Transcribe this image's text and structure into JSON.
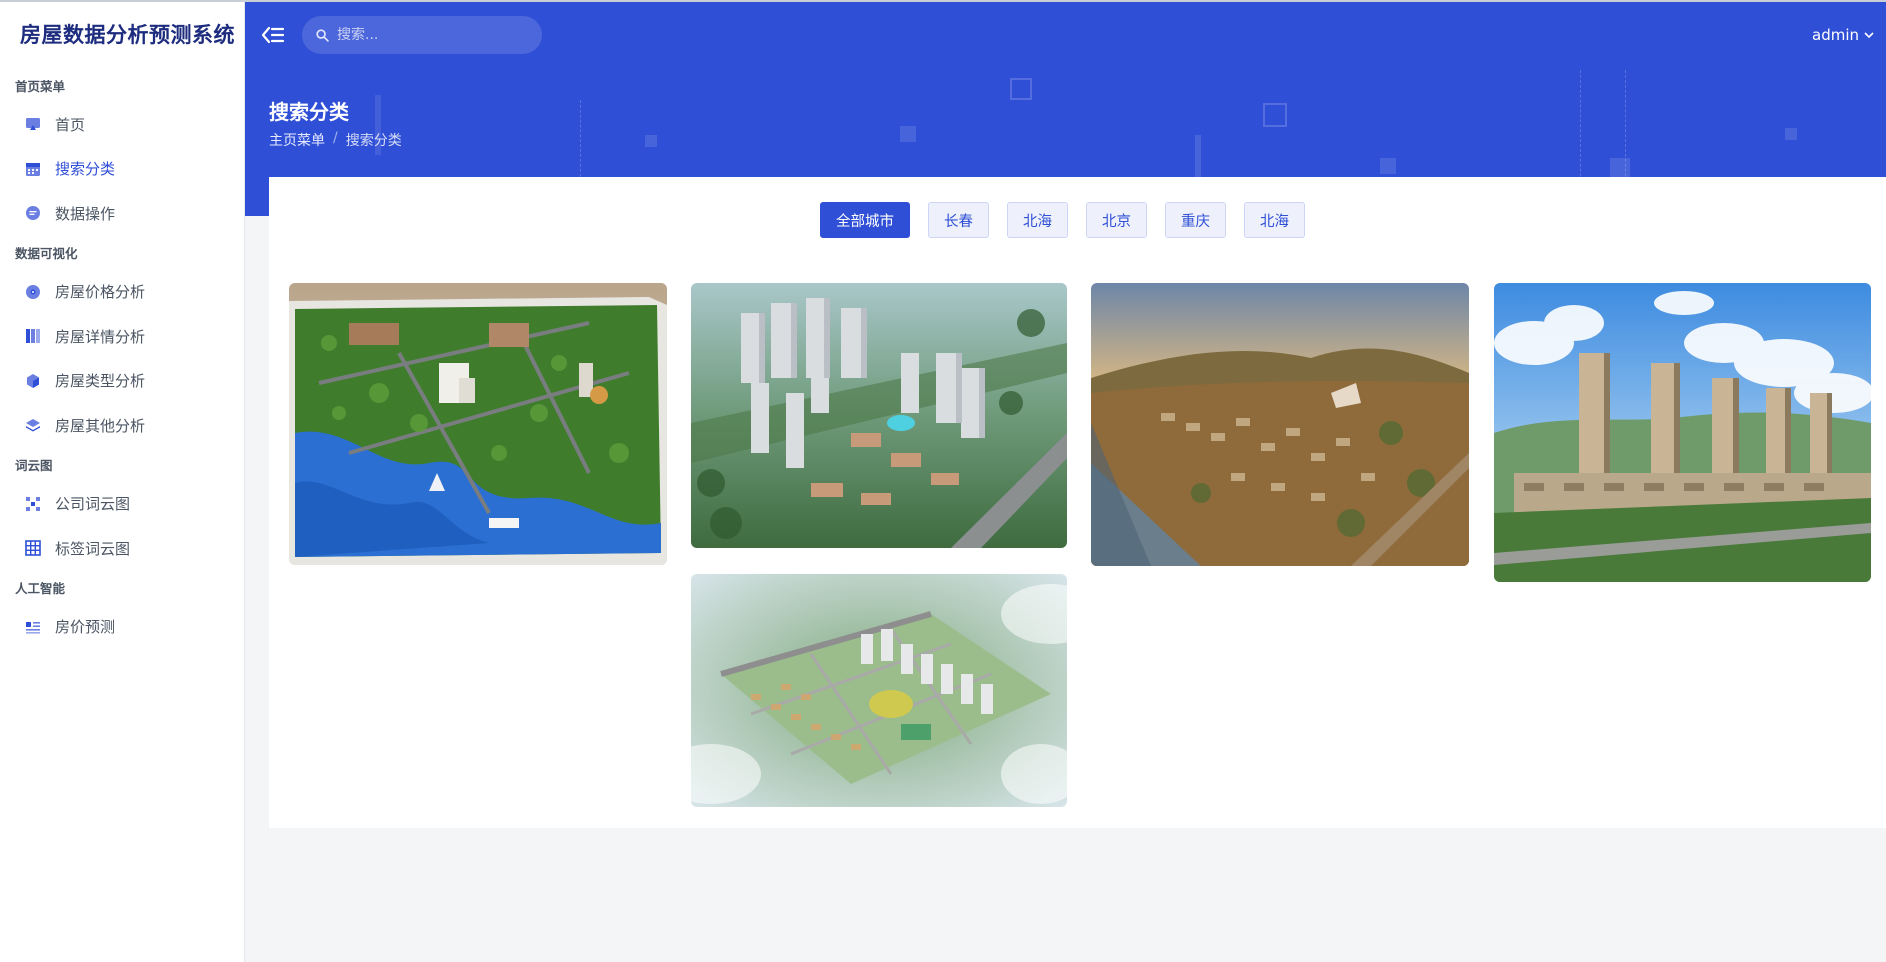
{
  "app": {
    "title": "房屋数据分析预测系统"
  },
  "sidebar": {
    "sections": [
      {
        "label": "首页菜单",
        "items": [
          {
            "label": "首页",
            "icon": "dashboard-icon"
          },
          {
            "label": "搜索分类",
            "icon": "calendar-icon",
            "active": true
          },
          {
            "label": "数据操作",
            "icon": "chat-icon"
          }
        ]
      },
      {
        "label": "数据可视化",
        "items": [
          {
            "label": "房屋价格分析",
            "icon": "compass-icon"
          },
          {
            "label": "房屋详情分析",
            "icon": "columns-icon"
          },
          {
            "label": "房屋类型分析",
            "icon": "cube-icon"
          },
          {
            "label": "房屋其他分析",
            "icon": "layers-icon"
          }
        ]
      },
      {
        "label": "词云图",
        "items": [
          {
            "label": "公司词云图",
            "icon": "nodes-icon"
          },
          {
            "label": "标签词云图",
            "icon": "grid-icon"
          }
        ]
      },
      {
        "label": "人工智能",
        "items": [
          {
            "label": "房价预测",
            "icon": "list-icon"
          }
        ]
      }
    ]
  },
  "header": {
    "search_placeholder": "搜索...",
    "user": "admin",
    "page_title": "搜索分类",
    "breadcrumb": {
      "root": "主页菜单",
      "current": "搜索分类",
      "sep": "/"
    }
  },
  "filters": [
    "全部城市",
    "长春",
    "北海",
    "北京",
    "重庆",
    "北海"
  ],
  "active_filter": "全部城市",
  "colors": {
    "primary": "#2f4fd6",
    "brand_text": "#1d2c7e"
  }
}
